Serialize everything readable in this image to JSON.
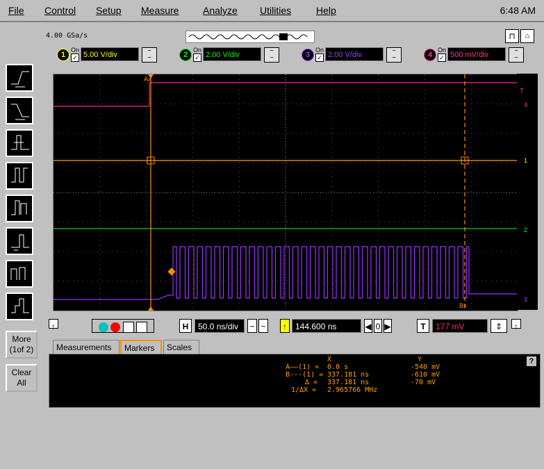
{
  "menu": {
    "items": [
      "File",
      "Control",
      "Setup",
      "Measure",
      "Analyze",
      "Utilities",
      "Help"
    ],
    "clock": "6:48 AM"
  },
  "acquisition": {
    "sample_rate": "4.00 GSa/s"
  },
  "channels": [
    {
      "num": "1",
      "on_label": "On",
      "scale": "5.00 V/div",
      "color": "#ffff00"
    },
    {
      "num": "2",
      "on_label": "On",
      "scale": "2.00 V/div",
      "color": "#00ff00"
    },
    {
      "num": "3",
      "on_label": "On",
      "scale": "2.00 V/div",
      "color": "#a040ff"
    },
    {
      "num": "4",
      "on_label": "On",
      "scale": "500 mV/div",
      "color": "#ff3399"
    }
  ],
  "colors": {
    "ch1": "#ffa500",
    "ch2": "#22cc22",
    "ch3": "#9933ff",
    "ch4": "#ff2288",
    "marker": "#ff8c00",
    "grid": "#555555"
  },
  "timebase": {
    "h_label": "H",
    "scale": "50.0 ns/div",
    "position": "144.600 ns",
    "trigger_label": "T",
    "trigger_level": "177 mV"
  },
  "side_buttons": {
    "more": "More\n(1of 2)",
    "more_line1": "More",
    "more_line2": "(1of 2)",
    "clear_line1": "Clear",
    "clear_line2": "All"
  },
  "tabs": {
    "measurements": "Measurements",
    "markers": "Markers",
    "scales": "Scales"
  },
  "markers": {
    "header_x": "X",
    "header_y": "Y",
    "row_a_label": "A——(1) =",
    "row_a_x": "0.0 s",
    "row_a_y": "-540 mV",
    "row_b_label": "B---(1) =",
    "row_b_x": "337.181 ns",
    "row_b_y": "-610 mV",
    "row_d_label": "Δ =",
    "row_d_x": "337.181 ns",
    "row_d_y": "-70 mV",
    "row_f_label": "1/ΔX =",
    "row_f_x": "2.965766 MHz"
  },
  "grid_labels": {
    "ax": "Ax",
    "bx": "Bx",
    "t": "T",
    "ch4_tag": "4",
    "ch1_tag": "1",
    "ch2_tag": "2",
    "ch3_tag": "3"
  },
  "help": "?"
}
